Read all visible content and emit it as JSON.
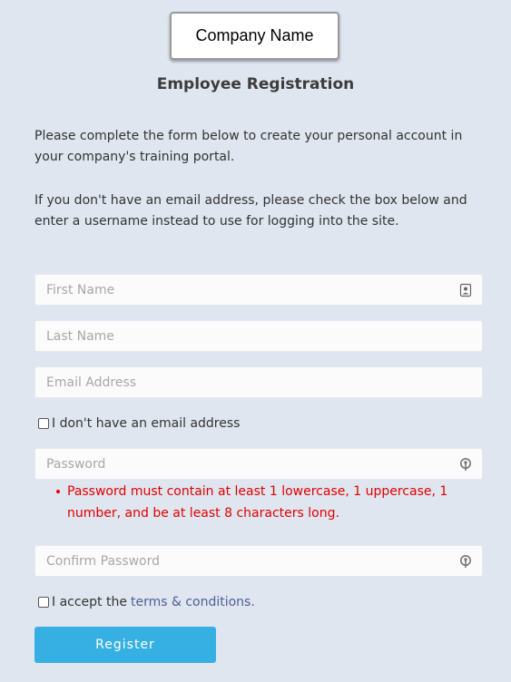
{
  "header": {
    "logo_text": "Company Name",
    "title": "Employee Registration"
  },
  "intro": {
    "paragraph_1": "Please complete the form below to create your personal account in your company's training portal.",
    "paragraph_2": "If you don't have an email address, please check the box below and enter a username instead to use for logging into the site."
  },
  "form": {
    "first_name": {
      "placeholder": "First Name",
      "value": "",
      "icon": "contact-card-icon"
    },
    "last_name": {
      "placeholder": "Last Name",
      "value": ""
    },
    "email": {
      "placeholder": "Email Address",
      "value": ""
    },
    "no_email_checkbox": {
      "label": "I don't have an email address",
      "checked": false
    },
    "password": {
      "placeholder": "Password",
      "value": "",
      "icon": "password-key-icon"
    },
    "password_error": "Password must contain at least 1 lowercase, 1 uppercase, 1 number, and be at least 8 characters long.",
    "confirm_password": {
      "placeholder": "Confirm Password",
      "value": "",
      "icon": "password-key-icon"
    },
    "terms_checkbox": {
      "label_prefix": "I accept the",
      "link_text": "terms & conditions.",
      "checked": false
    },
    "register_label": "Register"
  },
  "colors": {
    "background": "#dfe6ef",
    "button": "#36b0e3",
    "error": "#e10000",
    "link": "#4d5f96"
  }
}
